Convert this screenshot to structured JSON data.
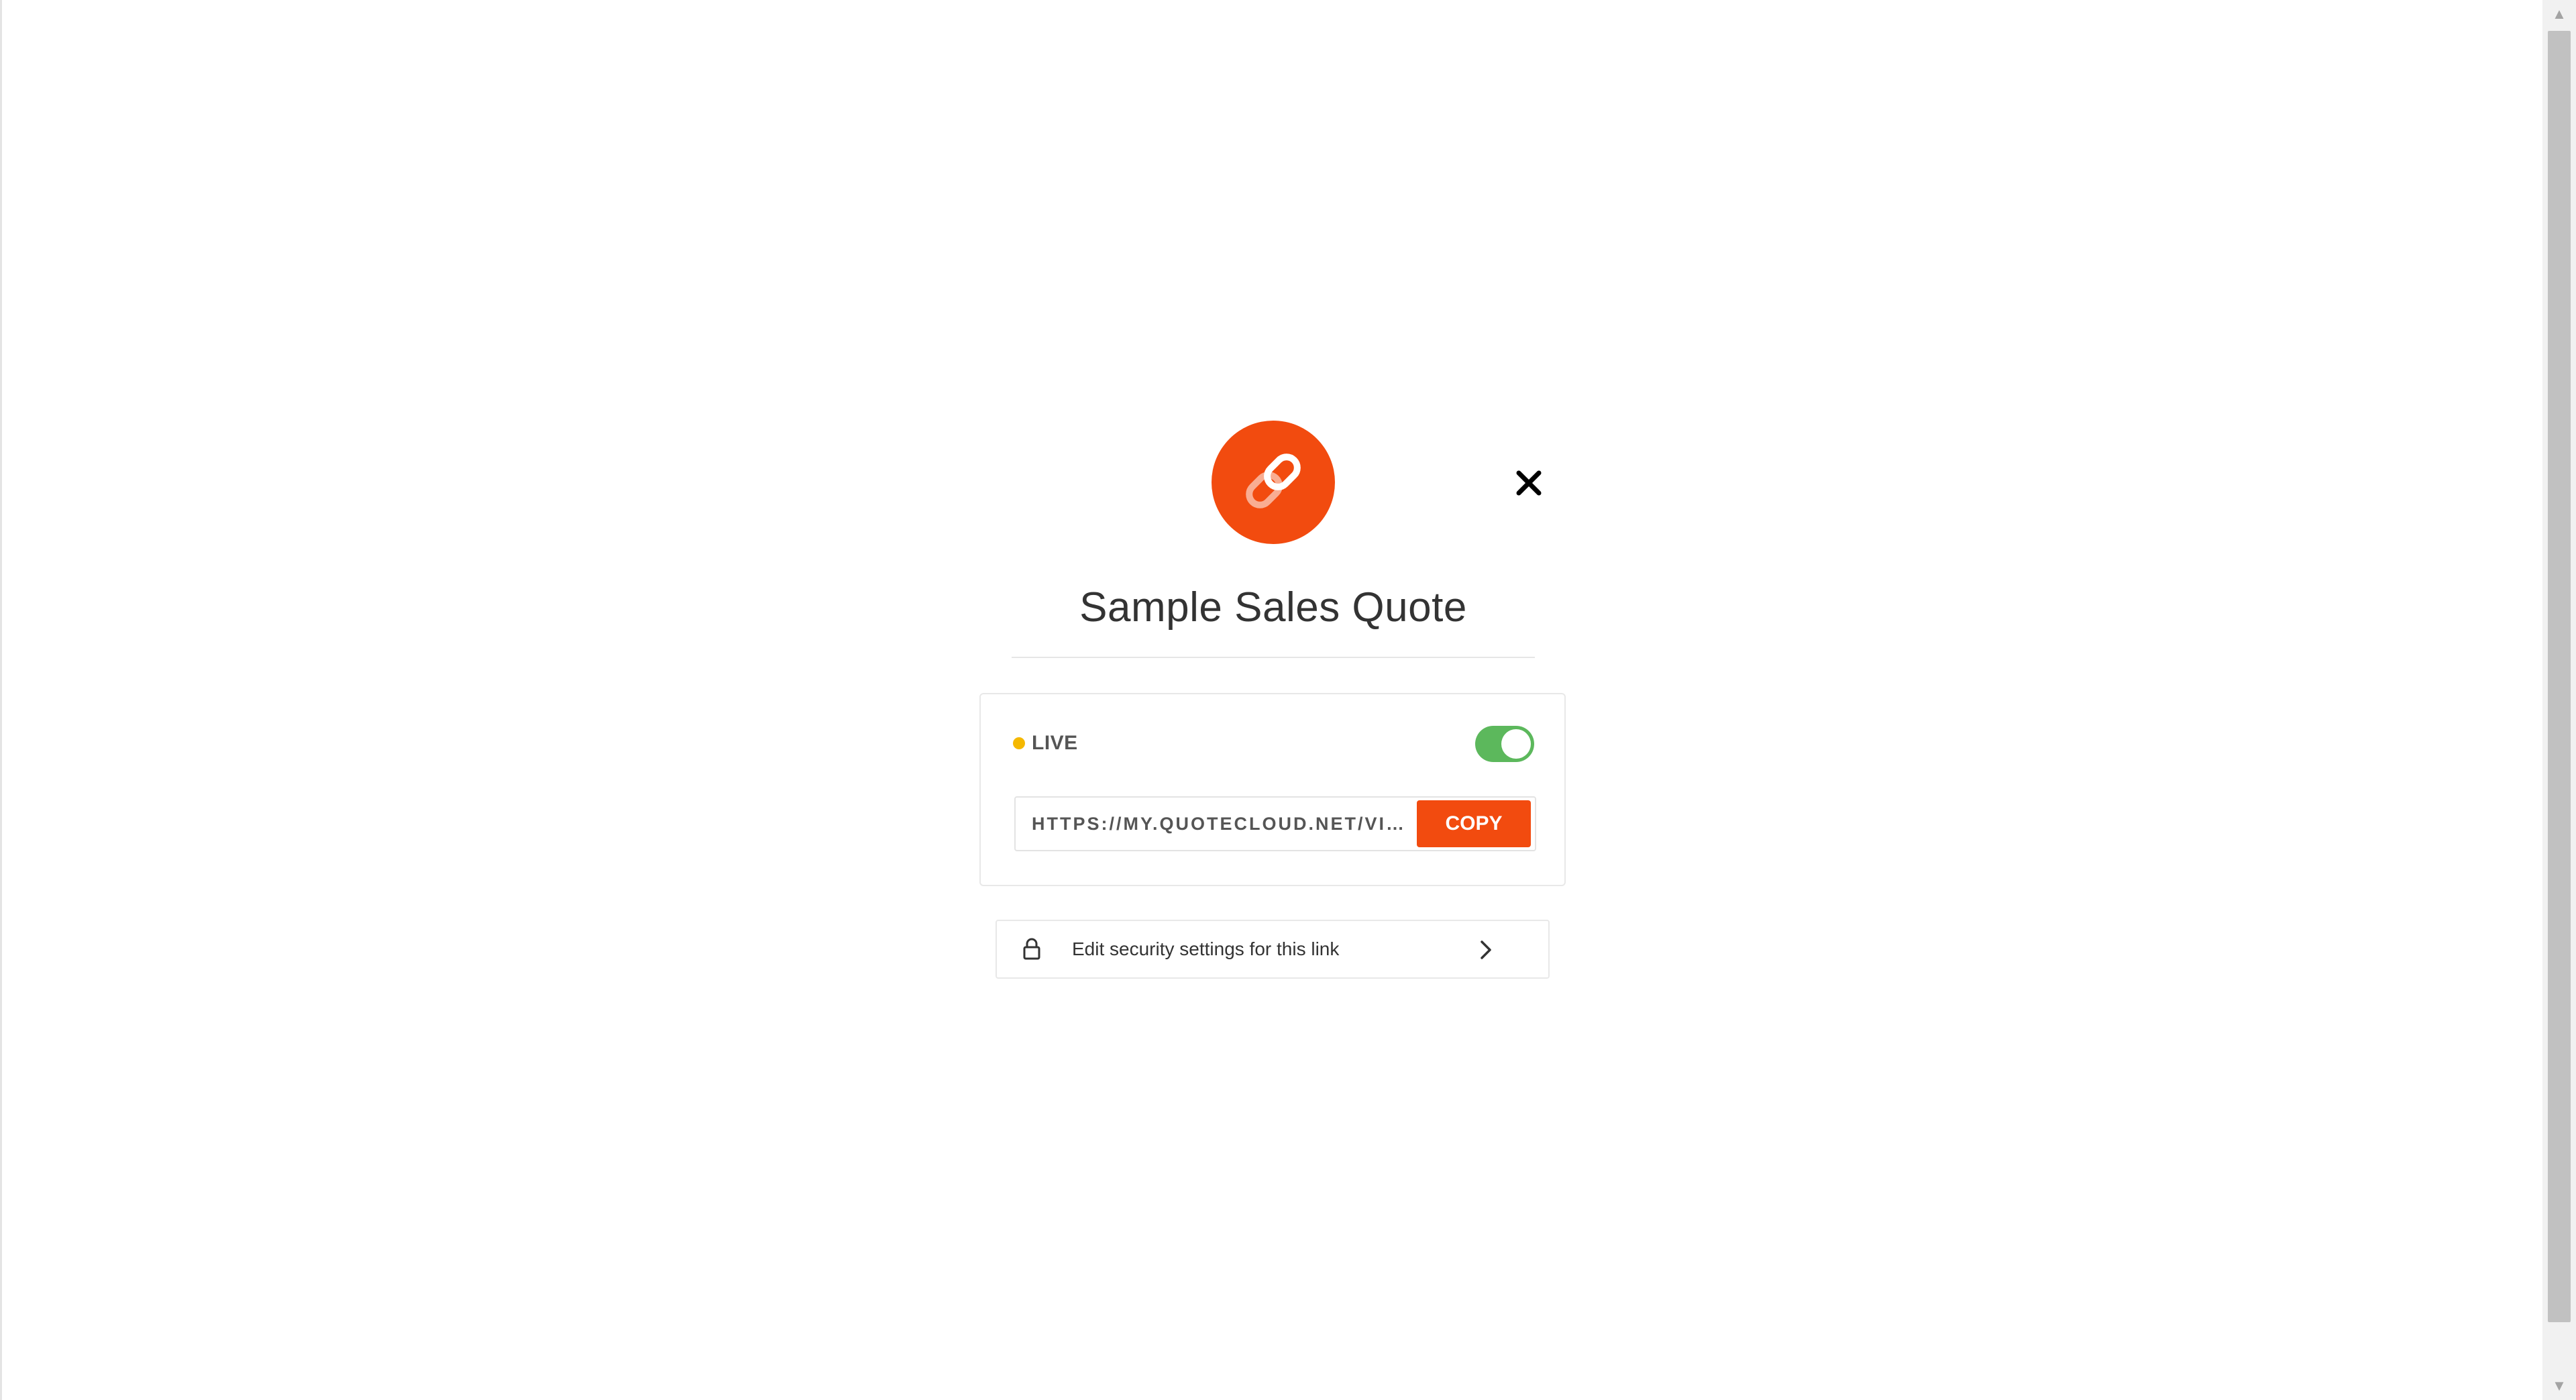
{
  "modal": {
    "icon": "link-icon",
    "close_icon": "close-icon",
    "title": "Sample Sales Quote"
  },
  "link_card": {
    "status_label": "LIVE",
    "status_color": "#f5b800",
    "toggle_on": true,
    "toggle_color": "#5cb85c",
    "url_value": "HTTPS://MY.QUOTECLOUD.NET/VIE...",
    "copy_label": "COPY"
  },
  "security": {
    "icon": "lock-icon",
    "label": "Edit security settings for this link",
    "chevron": "chevron-right-icon"
  },
  "colors": {
    "accent": "#f24b0f",
    "text": "#333333"
  },
  "scrollbar": {
    "up_icon": "scroll-up-arrow",
    "down_icon": "scroll-down-arrow"
  }
}
